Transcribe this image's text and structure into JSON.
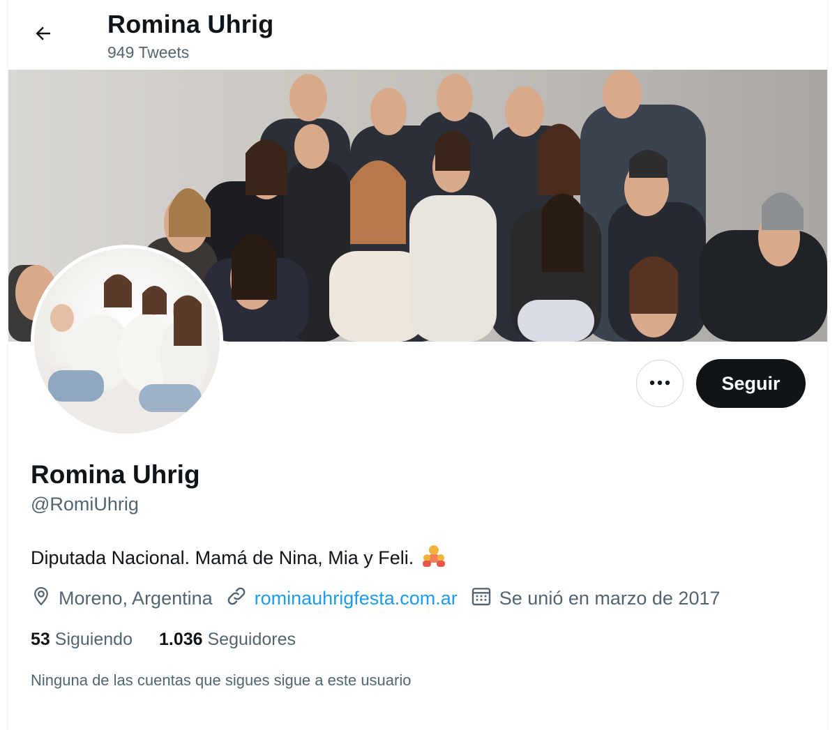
{
  "header": {
    "title": "Romina Uhrig",
    "tweet_count": "949 Tweets",
    "back_icon": "arrow-left-icon"
  },
  "profile": {
    "display_name": "Romina Uhrig",
    "handle": "@RomiUhrig",
    "bio": "Diputada Nacional. Mamá de Nina, Mia y Feli.",
    "bio_emoji": "family-emoji-icon",
    "location": "Moreno, Argentina",
    "website": "rominauhrigfesta.com.ar",
    "joined": "Se unió en marzo de 2017"
  },
  "actions": {
    "more_icon": "more-horizontal-icon",
    "follow_label": "Seguir"
  },
  "stats": {
    "following_count": "53",
    "following_label": "Siguiendo",
    "followers_count": "1.036",
    "followers_label": "Seguidores"
  },
  "note": "Ninguna de las cuentas que sigues sigue a este usuario",
  "colors": {
    "text": "#0f1419",
    "secondary": "#536471",
    "link": "#1d9bf0",
    "button": "#0f1419"
  }
}
